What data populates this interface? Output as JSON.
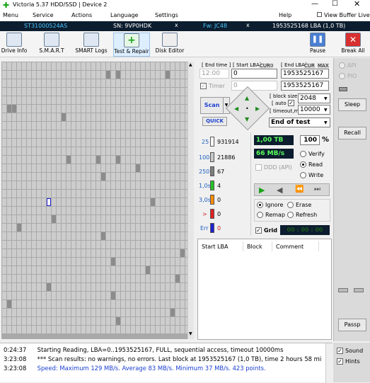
{
  "title": "Victoria 5.37 HDD/SSD | Device 2",
  "menu": [
    "Menu",
    "Service",
    "Actions",
    "Language",
    "Settings",
    "Help"
  ],
  "menu_right": "View Buffer Live",
  "drive": {
    "model": "ST31000524AS",
    "sn": "SN: 9VP0HDK",
    "fw": "Fw: JC48",
    "lba": "1953525168 LBA (1,0 TB)",
    "x1": "x",
    "x2": "x"
  },
  "toolbar": [
    "Drive Info",
    "S.M.A.R.T",
    "SMART Logs",
    "Test & Repair",
    "Disk Editor"
  ],
  "toolbar_right": [
    "Pause",
    "Break All"
  ],
  "range": {
    "end_time_label": "[ End time ]",
    "start_lba_label": "[ Start LBA]",
    "end_lba_label": "[ End LBA]",
    "cur1": "CUR",
    "cur1v": "0",
    "cur2": "CUR",
    "max": "MAX",
    "time_value": "12:00",
    "start_lba": "0",
    "end_lba": "1953525167",
    "timer_label": "Timer",
    "timer_value": "0",
    "lba_value": "1953525167"
  },
  "scan_btn": "Scan",
  "quick_btn": "QUICK",
  "block": {
    "size_label": "[ block size ]",
    "auto_label": "[ auto ]",
    "timeout_label": "[ timeout,ms ]",
    "size": "2048",
    "timeout": "10000",
    "end_mode": "End of test"
  },
  "counts": [
    {
      "label": "25",
      "value": "931914",
      "color": "#ffffff"
    },
    {
      "label": "100",
      "value": "21886",
      "color": "#c8c8c8"
    },
    {
      "label": "250",
      "value": "67",
      "color": "#7d7d7d"
    },
    {
      "label": "1,0s",
      "value": "4",
      "color": "#27c027"
    },
    {
      "label": "3,0s",
      "value": "0",
      "color": "#ff8c00"
    },
    {
      "label": ">",
      "value": "0",
      "color": "#e02020"
    },
    {
      "label": "Err",
      "value": "0",
      "color": "#2020d0"
    }
  ],
  "progress": {
    "size": "1,00 TB",
    "percent": "100",
    "pct_sign": "%",
    "speed": "66 MB/s",
    "ddd": "DDD (API)"
  },
  "modes": [
    "Verify",
    "Read",
    "Write"
  ],
  "actions": [
    "Ignore",
    "Erase",
    "Remap",
    "Refresh"
  ],
  "grid_label": "Grid",
  "grid_time": "00 : 00 : 00",
  "table_headers": [
    "Start LBA",
    "Block",
    "Comment"
  ],
  "side": {
    "api": "API",
    "pio": "PIO",
    "sleep": "Sleep",
    "recall": "Recall",
    "passp": "Passp",
    "sound": "Sound",
    "hints": "Hints"
  },
  "log": [
    {
      "time": "0:24:37",
      "text": "Starting Reading, LBA=0..1953525167, FULL, sequential access, timeout 10000ms",
      "color": "#000000"
    },
    {
      "time": "3:23:08",
      "text": "*** Scan results: no warnings, no errors. Last block at 1953525167 (1,0 TB), time 2 hours 58 minutes 3...",
      "color": "#000000"
    },
    {
      "time": "3:23:08",
      "text": "Speed: Maximum 129 MB/s. Average 83 MB/s. Minimum 37 MB/s. 423 points.",
      "color": "#1a3fd0"
    }
  ]
}
